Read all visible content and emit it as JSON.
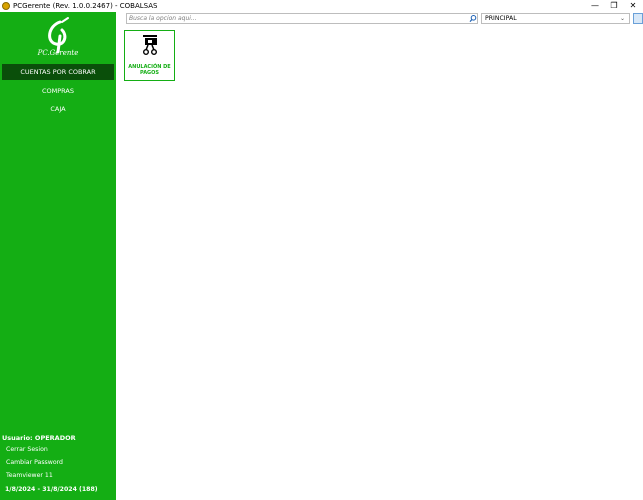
{
  "window": {
    "title": "PCGerente (Rev. 1.0.0.2467) - COBALSAS",
    "min_icon": "minimize-icon",
    "max_icon": "restore-icon",
    "close_icon": "close-icon"
  },
  "sidebar": {
    "logo_text": "PC.Gerente",
    "menu": [
      {
        "label": "CUENTAS POR COBRAR",
        "active": true
      },
      {
        "label": "COMPRAS",
        "active": false
      },
      {
        "label": "CAJA",
        "active": false
      }
    ],
    "user_label": "Usuario: OPERADOR",
    "links": [
      "Cerrar Sesion",
      "Cambiar Password",
      "Teamviewer 11"
    ],
    "date_range": "1/8/2024 - 31/8/2024 (188)",
    "colors": {
      "background": "#14ae14",
      "active": "#0a4f0a"
    }
  },
  "toolbar": {
    "search_placeholder": "Busca la opcion aqui...",
    "search_value": "",
    "select_value": "PRINCIPAL"
  },
  "tiles": [
    {
      "label": "ANULACIÓN DE PAGOS",
      "icon": "cut-payment-icon"
    }
  ]
}
